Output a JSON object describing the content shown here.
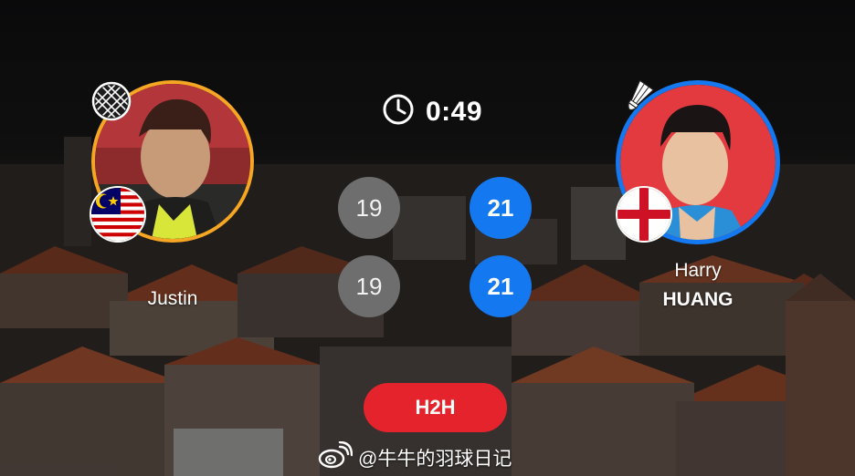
{
  "match": {
    "duration": "0:49",
    "timer_icon": "clock-icon"
  },
  "player_left": {
    "first_name": "Justin",
    "last_name": "",
    "country_flag": "malaysia-flag",
    "server_icon": "racket-icon",
    "ring_color": "#f5a623"
  },
  "player_right": {
    "first_name": "Harry",
    "last_name": "HUANG",
    "country_flag": "england-flag",
    "server_icon": "shuttlecock-icon",
    "ring_color": "#1479f0"
  },
  "games": [
    {
      "left": "19",
      "right": "21"
    },
    {
      "left": "19",
      "right": "21"
    }
  ],
  "colors": {
    "win": "#1479f0",
    "lose": "#6e6e6e",
    "h2h": "#e4232d"
  },
  "h2h_label": "H2H",
  "watermark": {
    "icon": "weibo-icon",
    "text": "@牛牛的羽球日记"
  }
}
